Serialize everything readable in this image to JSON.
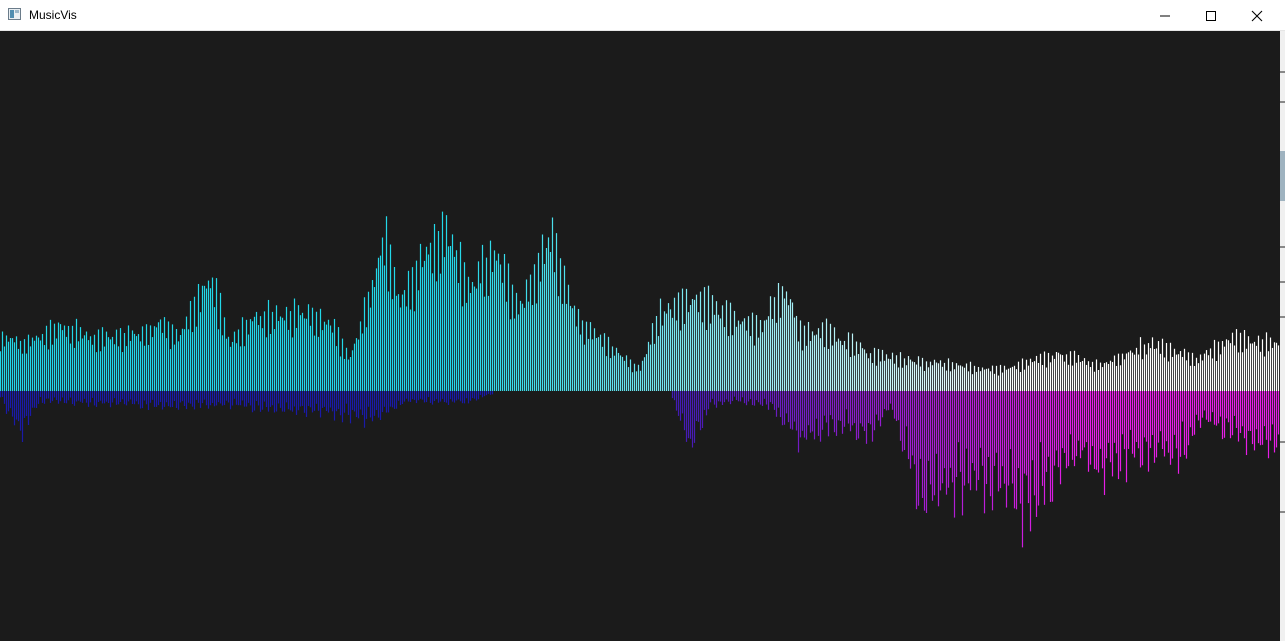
{
  "window": {
    "title": "MusicVis",
    "icon": "app-window-icon"
  },
  "controls": {
    "minimize": "minimize-icon",
    "maximize": "maximize-icon",
    "close": "close-icon"
  },
  "colors": {
    "background": "#1b1b1b",
    "positive_start": "#22d8e8",
    "positive_end": "#ffffff",
    "negative_start": "#1a1aa8",
    "negative_end": "#e61ee6"
  },
  "chart_data": {
    "type": "bar",
    "bar_count": 640,
    "values_note": "",
    "positive_envelope": [
      [
        0,
        0.22
      ],
      [
        20,
        0.18
      ],
      [
        60,
        0.24
      ],
      [
        100,
        0.2
      ],
      [
        140,
        0.22
      ],
      [
        160,
        0.26
      ],
      [
        180,
        0.2
      ],
      [
        210,
        0.44
      ],
      [
        230,
        0.18
      ],
      [
        255,
        0.28
      ],
      [
        280,
        0.28
      ],
      [
        300,
        0.3
      ],
      [
        330,
        0.26
      ],
      [
        350,
        0.12
      ],
      [
        385,
        0.58
      ],
      [
        400,
        0.34
      ],
      [
        445,
        0.62
      ],
      [
        470,
        0.4
      ],
      [
        495,
        0.52
      ],
      [
        520,
        0.3
      ],
      [
        550,
        0.6
      ],
      [
        575,
        0.28
      ],
      [
        600,
        0.2
      ],
      [
        640,
        0.08
      ],
      [
        660,
        0.3
      ],
      [
        700,
        0.34
      ],
      [
        720,
        0.3
      ],
      [
        760,
        0.24
      ],
      [
        785,
        0.4
      ],
      [
        800,
        0.22
      ],
      [
        830,
        0.22
      ],
      [
        870,
        0.14
      ],
      [
        900,
        0.12
      ],
      [
        950,
        0.1
      ],
      [
        1000,
        0.08
      ],
      [
        1060,
        0.14
      ],
      [
        1100,
        0.1
      ],
      [
        1150,
        0.18
      ],
      [
        1200,
        0.12
      ],
      [
        1230,
        0.2
      ],
      [
        1280,
        0.18
      ]
    ],
    "negative_envelope": [
      [
        0,
        0.02
      ],
      [
        20,
        0.18
      ],
      [
        40,
        0.04
      ],
      [
        150,
        0.06
      ],
      [
        180,
        0.06
      ],
      [
        235,
        0.06
      ],
      [
        350,
        0.1
      ],
      [
        370,
        0.12
      ],
      [
        410,
        0.04
      ],
      [
        465,
        0.05
      ],
      [
        500,
        0.0
      ],
      [
        670,
        0.0
      ],
      [
        690,
        0.24
      ],
      [
        710,
        0.06
      ],
      [
        740,
        0.04
      ],
      [
        770,
        0.06
      ],
      [
        800,
        0.2
      ],
      [
        830,
        0.14
      ],
      [
        870,
        0.18
      ],
      [
        890,
        0.06
      ],
      [
        920,
        0.44
      ],
      [
        960,
        0.4
      ],
      [
        1000,
        0.38
      ],
      [
        1020,
        0.5
      ],
      [
        1040,
        0.42
      ],
      [
        1080,
        0.24
      ],
      [
        1100,
        0.34
      ],
      [
        1140,
        0.26
      ],
      [
        1180,
        0.28
      ],
      [
        1200,
        0.12
      ],
      [
        1260,
        0.22
      ],
      [
        1280,
        0.24
      ]
    ]
  }
}
